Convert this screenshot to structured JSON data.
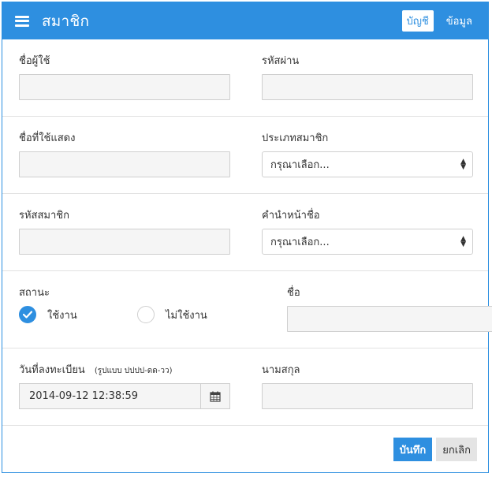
{
  "header": {
    "title": "สมาชิก",
    "tabs": [
      {
        "label": "บัญชี",
        "active": true
      },
      {
        "label": "ข้อมูล",
        "active": false
      }
    ]
  },
  "form": {
    "username": {
      "label": "ชื่อผู้ใช้",
      "value": ""
    },
    "password": {
      "label": "รหัสผ่าน",
      "value": ""
    },
    "display_name": {
      "label": "ชื่อที่ใช้แสดง",
      "value": ""
    },
    "member_type": {
      "label": "ประเภทสมาชิก",
      "selected": "กรุณาเลือก..."
    },
    "member_code": {
      "label": "รหัสสมาชิก",
      "value": ""
    },
    "prefix": {
      "label": "คำนำหน้าชื่อ",
      "selected": "กรุณาเลือก..."
    },
    "status": {
      "label": "สถานะ",
      "options": [
        {
          "label": "ใช้งาน",
          "checked": true
        },
        {
          "label": "ไม่ใช้งาน",
          "checked": false
        }
      ]
    },
    "first_name": {
      "label": "ชื่อ",
      "value": ""
    },
    "register_date": {
      "label": "วันที่ลงทะเบียน",
      "hint": "(รูปแบบ ปปปป-ดด-วว)",
      "value": "2014-09-12 12:38:59"
    },
    "last_name": {
      "label": "นามสกุล",
      "value": ""
    }
  },
  "footer": {
    "save_label": "บันทึก",
    "cancel_label": "ยกเลิก"
  },
  "colors": {
    "accent": "#2e8fe0"
  }
}
